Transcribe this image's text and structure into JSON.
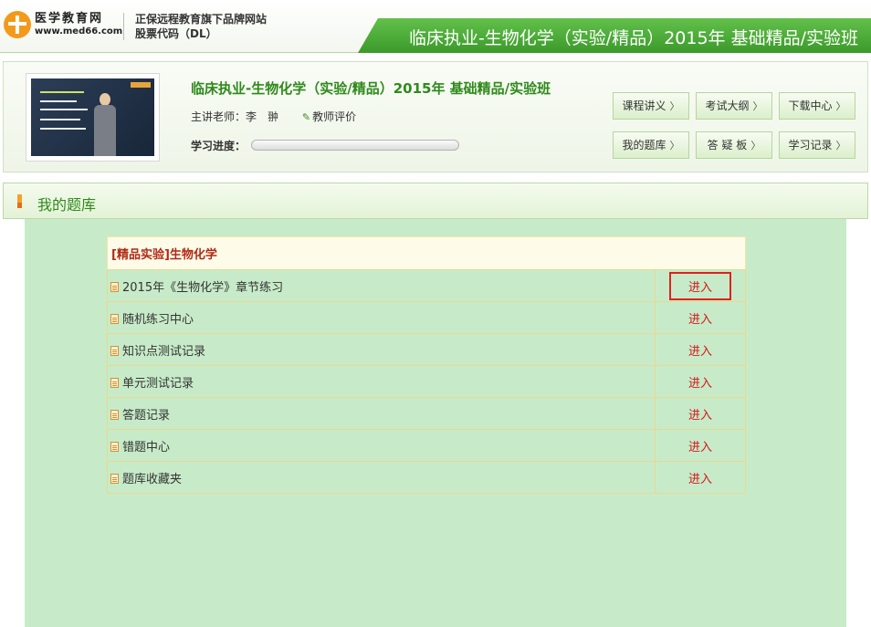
{
  "header": {
    "logo_name": "医学教育网",
    "logo_url": "www.med66.com",
    "slogan_line1": "正保远程教育旗下品牌网站",
    "slogan_line2": "股票代码（DL）",
    "page_title": "临床执业-生物化学（实验/精品）2015年 基础精品/实验班"
  },
  "course": {
    "title": "临床执业-生物化学（实验/精品）2015年 基础精品/实验班",
    "teacher_label": "主讲老师：李　翀",
    "evaluate_label": "教师评价",
    "progress_label": "学习进度：",
    "progress_percent": 0
  },
  "buttons": {
    "lecture": "课程讲义",
    "syllabus": "考试大纲",
    "download": "下载中心",
    "question_bank": "我的题库",
    "qa_board": "答 疑 板",
    "study_record": "学习记录",
    "chevron": "〉"
  },
  "section": {
    "title": "我的题库"
  },
  "bank": {
    "header": "[精品实验]生物化学",
    "enter_label": "进入",
    "rows": [
      {
        "name": "2015年《生物化学》章节练习"
      },
      {
        "name": "随机练习中心"
      },
      {
        "name": "知识点测试记录"
      },
      {
        "name": "单元测试记录"
      },
      {
        "name": "答题记录"
      },
      {
        "name": "错题中心"
      },
      {
        "name": "题库收藏夹"
      }
    ]
  },
  "colors": {
    "brand_green": "#2f8a1b",
    "link_red": "#d41616",
    "content_bg": "#c7ebc9"
  }
}
